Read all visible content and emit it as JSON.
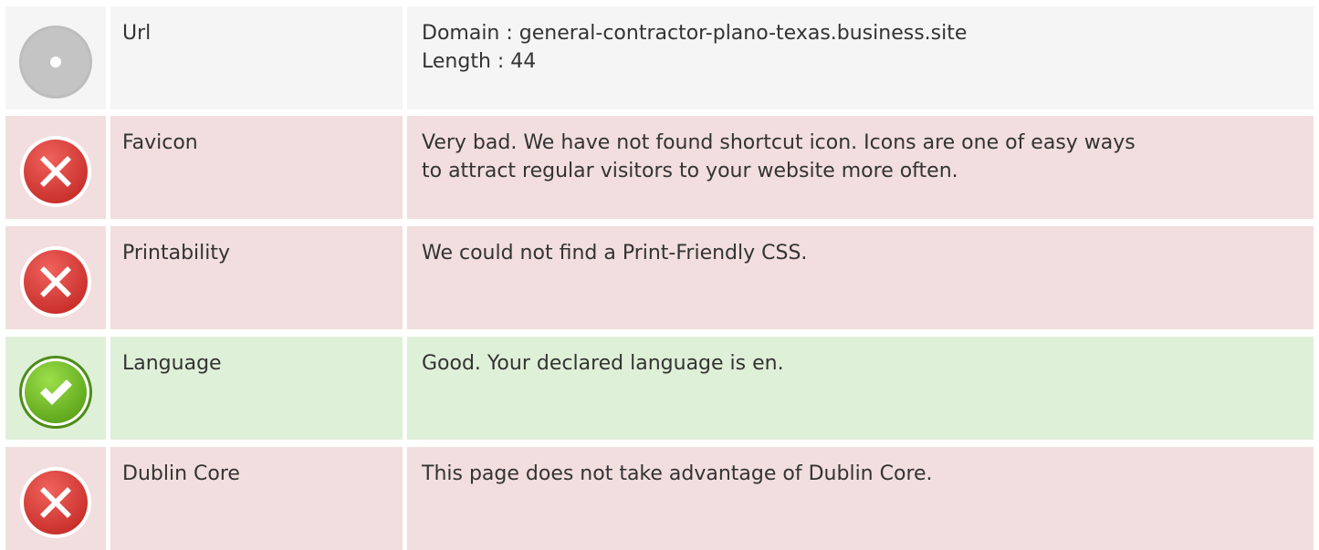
{
  "rows": [
    {
      "status": "neutral",
      "icon": "info-circle-icon",
      "label": "Url",
      "lines": [
        "Domain : general-contractor-plano-texas.business.site",
        "Length : 44"
      ]
    },
    {
      "status": "bad",
      "icon": "error-x-icon",
      "label": "Favicon",
      "lines": [
        "Very bad. We have not found shortcut icon. Icons are one of easy ways",
        "to attract regular visitors to your website more often."
      ]
    },
    {
      "status": "bad",
      "icon": "error-x-icon",
      "label": "Printability",
      "lines": [
        "We could not find a Print-Friendly CSS."
      ]
    },
    {
      "status": "good",
      "icon": "check-circle-icon",
      "label": "Language",
      "lines": [
        "Good. Your declared language is en."
      ]
    },
    {
      "status": "bad",
      "icon": "error-x-icon",
      "label": "Dublin Core",
      "lines": [
        "This page does not take advantage of Dublin Core."
      ]
    }
  ],
  "colors": {
    "neutral_bg": "#f5f5f5",
    "bad_bg": "#f2dede",
    "good_bg": "#dff0d8",
    "error_red": "#d9423f",
    "success_green": "#7cc32a",
    "neutral_gray": "#bfbfbf"
  }
}
